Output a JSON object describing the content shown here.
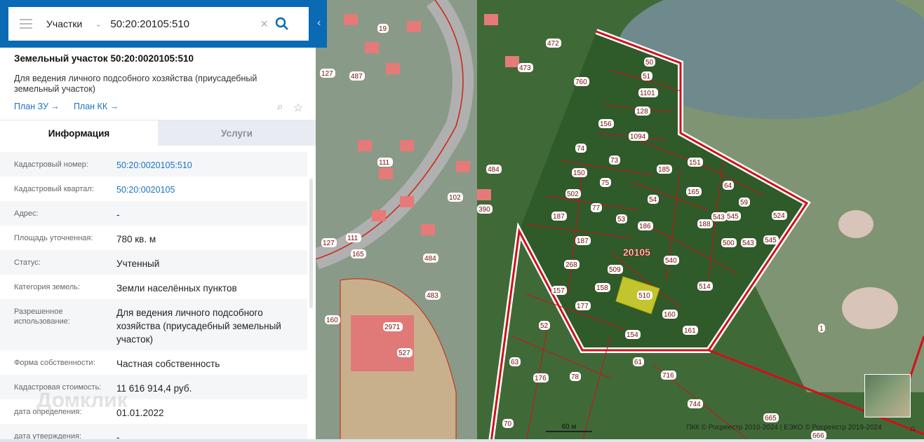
{
  "search": {
    "category": "Участки",
    "query": "50:20:20105:510"
  },
  "parcel": {
    "title": "Земельный участок 50:20:0020105:510",
    "purpose": "Для ведения личного подсобного хозяйства (приусадебный земельный участок)",
    "link_plan_zu": "План ЗУ →",
    "link_plan_kk": "План КК →"
  },
  "tabs": {
    "info": "Информация",
    "services": "Услуги"
  },
  "rows": [
    {
      "k": "Кадастровый номер:",
      "v": "50:20:0020105:510"
    },
    {
      "k": "Кадастровый квартал:",
      "v": "50:20:0020105"
    },
    {
      "k": "Адрес:",
      "v": "-"
    },
    {
      "k": "Площадь уточненная:",
      "v": "780 кв. м"
    },
    {
      "k": "Статус:",
      "v": "Учтенный"
    },
    {
      "k": "Категория земель:",
      "v": "Земли населённых пунктов"
    },
    {
      "k": "Разрешенное использование:",
      "v": "Для ведения личного подсобного хозяйства (приусадебный земельный участок)"
    },
    {
      "k": "Форма собственности:",
      "v": "Частная собственность"
    },
    {
      "k": "Кадастровая стоимость:",
      "v": "11 616 914,4 руб."
    },
    {
      "k": "дата определения:",
      "v": "01.01.2022"
    },
    {
      "k": "дата утверждения:",
      "v": "-"
    }
  ],
  "watermark": "Домклик",
  "map": {
    "labels": [
      "19",
      "472",
      "473",
      "487",
      "127",
      "111",
      "484",
      "102",
      "390",
      "127",
      "111",
      "165",
      "484",
      "483",
      "160",
      "2971",
      "527",
      "50",
      "51",
      "1101",
      "128",
      "1094",
      "760",
      "156",
      "74",
      "73",
      "185",
      "151",
      "150",
      "75",
      "64",
      "59",
      "524",
      "165",
      "502",
      "77",
      "54",
      "545",
      "543",
      "187",
      "53",
      "186",
      "188",
      "545",
      "543",
      "500",
      "187",
      "20105",
      "540",
      "268",
      "509",
      "510",
      "157",
      "158",
      "514",
      "177",
      "160",
      "161",
      "52",
      "154",
      "63",
      "176",
      "78",
      "61",
      "716",
      "744",
      "665",
      "666",
      "70",
      "1"
    ],
    "scale": "60 м",
    "attribution": "ПКК © Росреестр 2010-2024 | ЕЭКО © Росреестр 2019-2024"
  },
  "colors": {
    "header": "#0a6ab4",
    "link": "#1a73c0",
    "parcel_border": "#d0101a",
    "selected": "#e8e030"
  }
}
